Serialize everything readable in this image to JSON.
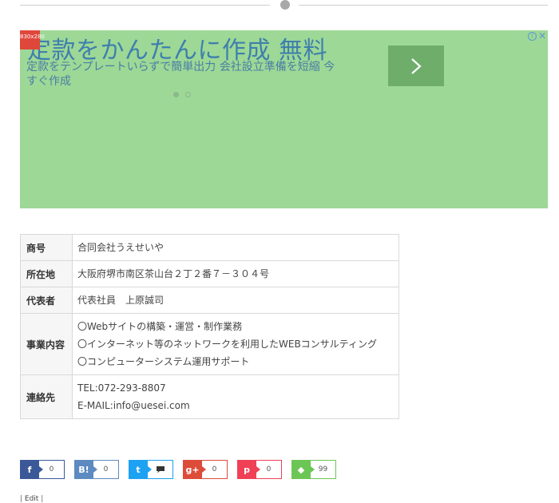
{
  "ad": {
    "size_badge": "830x280",
    "title": "定款をかんたんに作成 無料",
    "description": "定款をテンプレートいらずで簡単出力 会社設立準備を短縮 今すぐ作成",
    "arrow_icon": "chevron-right-icon",
    "info_icon": "info-icon",
    "close_icon": "close-icon",
    "close_glyph": "✕",
    "info_glyph": "i",
    "colors": {
      "background": "#9dd896",
      "title": "#3f7fae",
      "button": "#6ead6a",
      "badge": "#e0473b"
    }
  },
  "company_table": {
    "rows": [
      {
        "label": "商号",
        "lines": [
          "合同会社うえせいや"
        ]
      },
      {
        "label": "所在地",
        "lines": [
          "大阪府堺市南区茶山台２丁２番７－３０４号"
        ]
      },
      {
        "label": "代表者",
        "lines": [
          "代表社員　上原誠司"
        ]
      },
      {
        "label": "事業内容",
        "lines": [
          "〇Webサイトの構築・運営・制作業務",
          "〇インターネット等のネットワークを利用したWEBコンサルティング",
          "〇コンピューターシステム運用サポート"
        ]
      },
      {
        "label": "連絡先",
        "lines": [
          "TEL:072-293-8807",
          "E-MAIL:info@uesei.com"
        ]
      }
    ]
  },
  "share_buttons": [
    {
      "name": "facebook",
      "icon": "facebook-icon",
      "glyph": "f",
      "count": "0",
      "color": "#3b5998"
    },
    {
      "name": "hatena",
      "icon": "hatena-bookmark-icon",
      "glyph": "B!",
      "count": "0",
      "color": "#5d8ac1"
    },
    {
      "name": "twitter",
      "icon": "twitter-icon",
      "glyph": "t",
      "count": "",
      "color": "#1da1f2"
    },
    {
      "name": "googleplus",
      "icon": "google-plus-icon",
      "glyph": "g+",
      "count": "0",
      "color": "#dd4b39"
    },
    {
      "name": "pocket",
      "icon": "pocket-icon",
      "glyph": "p",
      "count": "0",
      "color": "#ef4056"
    },
    {
      "name": "feedly",
      "icon": "feedly-icon",
      "glyph": "◆",
      "count": "99",
      "color": "#6cc655"
    }
  ],
  "footer": {
    "edit_prefix": "| ",
    "edit_label": "Edit",
    "edit_suffix": " |"
  }
}
